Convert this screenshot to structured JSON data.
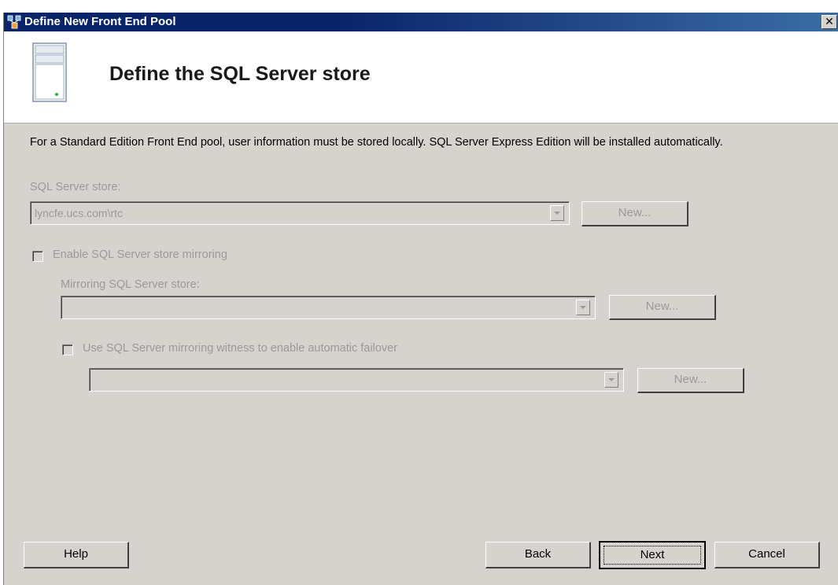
{
  "window": {
    "title": "Define New Front End Pool",
    "close_label": "✕"
  },
  "header": {
    "title": "Define the SQL Server store"
  },
  "description": "For a Standard Edition Front End pool, user information must be stored locally.  SQL Server Express Edition will be installed automatically.",
  "sql_store": {
    "label": "SQL Server store:",
    "value": "lyncfe.ucs.com\\rtc",
    "new_label": "New..."
  },
  "mirroring": {
    "checkbox_label": "Enable SQL Server store mirroring",
    "checked": false,
    "store_label": "Mirroring SQL Server store:",
    "store_value": "",
    "new_label": "New..."
  },
  "witness": {
    "checkbox_label": "Use SQL Server mirroring witness to enable automatic failover",
    "checked": false,
    "value": "",
    "new_label": "New..."
  },
  "footer": {
    "help_label": "Help",
    "back_label": "Back",
    "next_label": "Next",
    "cancel_label": "Cancel"
  },
  "colors": {
    "titlebar": "#0a246a",
    "dialog_background": "#d6d3ce",
    "disabled_text": "#9a9a9a"
  }
}
